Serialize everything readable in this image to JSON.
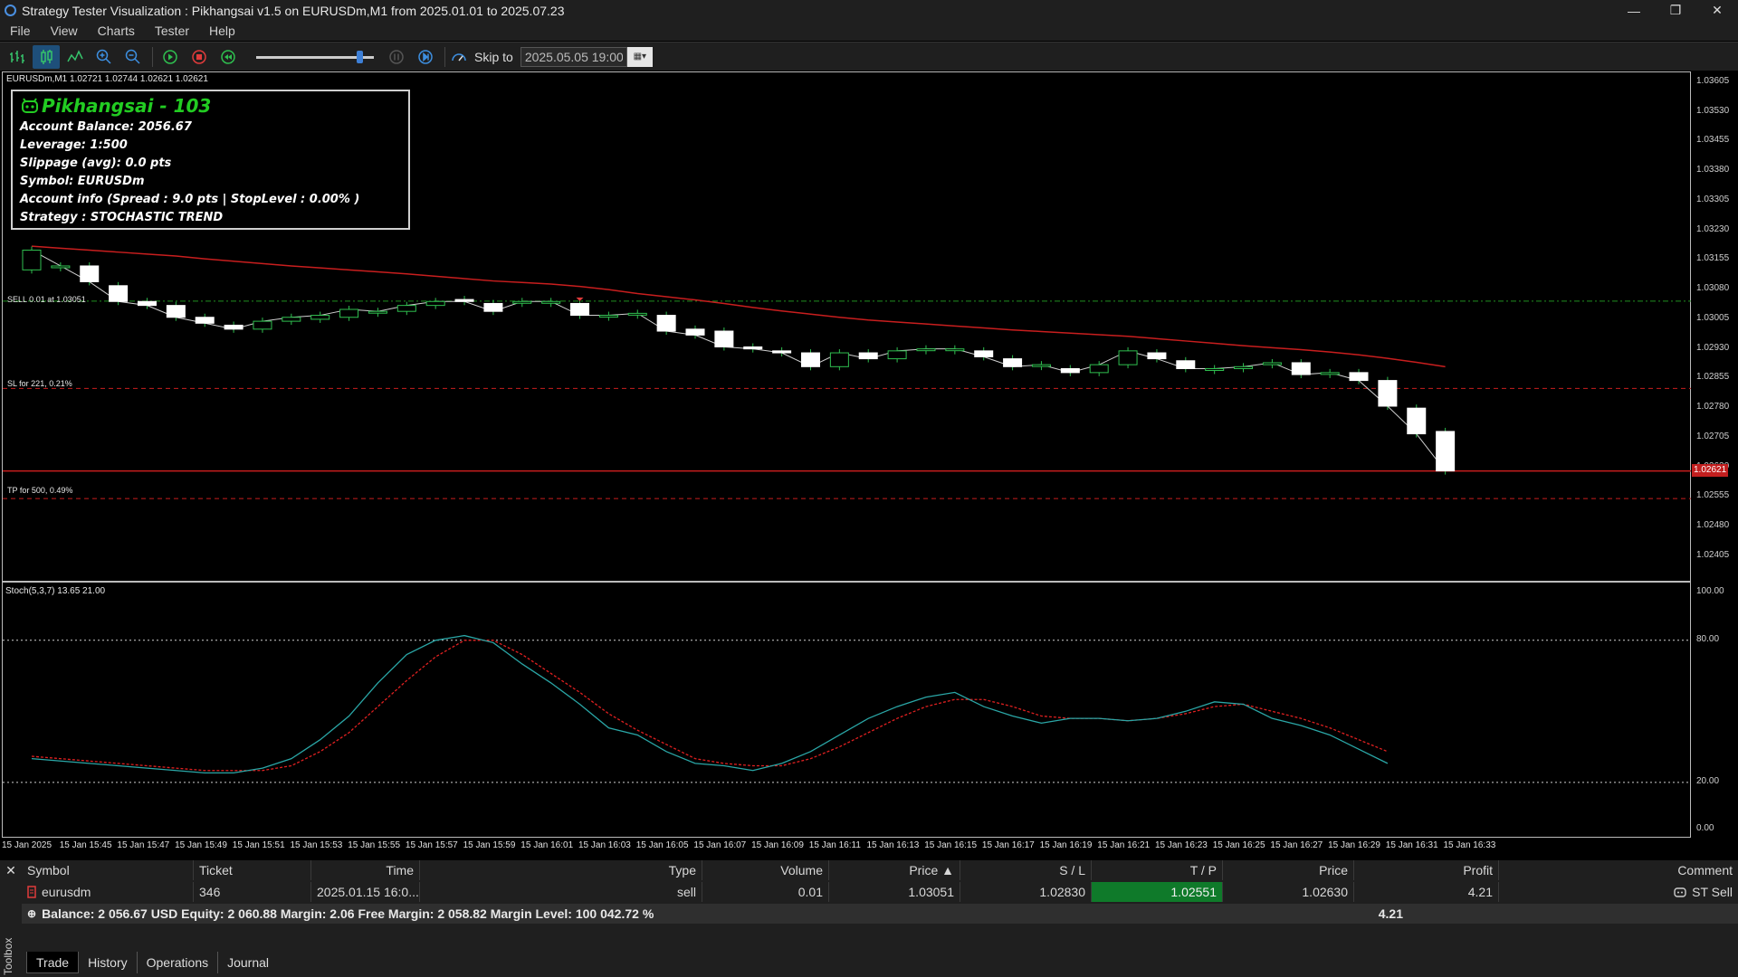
{
  "window": {
    "title": "Strategy Tester Visualization : Pikhangsai v1.5 on EURUSDm,M1 from 2025.01.01 to 2025.07.23",
    "minimize": "—",
    "restore": "❐",
    "close": "✕"
  },
  "menu": [
    "File",
    "View",
    "Charts",
    "Tester",
    "Help"
  ],
  "toolbar": {
    "skip_label": "Skip to",
    "skip_value": "2025.05.05 19:00",
    "speed_fraction": 0.9
  },
  "chart": {
    "header": "EURUSDm,M1  1.02721 1.02744 1.02621 1.02621",
    "stoch_header": "Stoch(5,3,7) 13.65 21.00",
    "price_axis": [
      "1.03605",
      "1.03530",
      "1.03455",
      "1.03380",
      "1.03305",
      "1.03230",
      "1.03155",
      "1.03080",
      "1.03005",
      "1.02930",
      "1.02855",
      "1.02780",
      "1.02705",
      "1.02630",
      "1.02555",
      "1.02480",
      "1.02405"
    ],
    "current_price": "1.02621",
    "stoch_axis": [
      "100.00",
      "80.00",
      "20.00",
      "0.00"
    ],
    "time_axis": [
      "15 Jan 2025",
      "15 Jan 15:45",
      "15 Jan 15:47",
      "15 Jan 15:49",
      "15 Jan 15:51",
      "15 Jan 15:53",
      "15 Jan 15:55",
      "15 Jan 15:57",
      "15 Jan 15:59",
      "15 Jan 16:01",
      "15 Jan 16:03",
      "15 Jan 16:05",
      "15 Jan 16:07",
      "15 Jan 16:09",
      "15 Jan 16:11",
      "15 Jan 16:13",
      "15 Jan 16:15",
      "15 Jan 16:17",
      "15 Jan 16:19",
      "15 Jan 16:21",
      "15 Jan 16:23",
      "15 Jan 16:25",
      "15 Jan 16:27",
      "15 Jan 16:29",
      "15 Jan 16:31",
      "15 Jan 16:33"
    ],
    "levels": {
      "sell": "SELL 0.01 at 1.03051",
      "sl": "SL for 221, 0.21%",
      "tp": "TP for 500, 0.49%"
    },
    "colors": {
      "bull": "#000000",
      "bear": "#ffffff",
      "ma": "#c81e1e",
      "stoch_main": "#2aa6a6",
      "stoch_signal": "#e02020",
      "sell_line": "#1f8f1f",
      "sl_line": "#c81e1e",
      "tp_line": "#c81e1e"
    }
  },
  "info_panel": {
    "title": "Pikhangsai - 103",
    "lines": [
      "Account Balance: 2056.67",
      "Leverage: 1:500",
      "Slippage (avg): 0.0 pts",
      "Symbol: EURUSDm",
      "Account info (Spread : 9.0 pts | StopLevel : 0.00% )",
      "Strategy : STOCHASTIC TREND"
    ]
  },
  "toolbox": {
    "label": "Toolbox",
    "columns": [
      "Symbol",
      "Ticket",
      "Time",
      "Type",
      "Volume",
      "Price ▲",
      "S / L",
      "T / P",
      "Price",
      "Profit",
      "Comment"
    ],
    "row": {
      "symbol": "eurusdm",
      "ticket": "346",
      "time": "2025.01.15 16:0...",
      "type": "sell",
      "volume": "0.01",
      "price": "1.03051",
      "sl": "1.02830",
      "tp": "1.02551",
      "current": "1.02630",
      "profit": "4.21",
      "comment": "ST Sell"
    },
    "balance": "Balance: 2 056.67 USD  Equity: 2 060.88  Margin: 2.06  Free Margin: 2 058.82  Margin Level: 100 042.72 %",
    "balance_profit": "4.21",
    "tabs": [
      "Trade",
      "History",
      "Operations",
      "Journal"
    ]
  },
  "chart_data": {
    "type": "candlestick",
    "candles": [
      {
        "o": 1.0313,
        "c": 1.0318
      },
      {
        "o": 1.0314,
        "c": 1.0314
      },
      {
        "o": 1.0314,
        "c": 1.031
      },
      {
        "o": 1.0309,
        "c": 1.0305
      },
      {
        "o": 1.0305,
        "c": 1.0304
      },
      {
        "o": 1.0304,
        "c": 1.0301
      },
      {
        "o": 1.0301,
        "c": 1.02995
      },
      {
        "o": 1.0299,
        "c": 1.0298
      },
      {
        "o": 1.0298,
        "c": 1.03
      },
      {
        "o": 1.03,
        "c": 1.0301
      },
      {
        "o": 1.03005,
        "c": 1.03015
      },
      {
        "o": 1.0301,
        "c": 1.0303
      },
      {
        "o": 1.03025,
        "c": 1.03025
      },
      {
        "o": 1.03025,
        "c": 1.0304
      },
      {
        "o": 1.0304,
        "c": 1.0305
      },
      {
        "o": 1.03055,
        "c": 1.0305
      },
      {
        "o": 1.03045,
        "c": 1.03025
      },
      {
        "o": 1.0305,
        "c": 1.0305
      },
      {
        "o": 1.0305,
        "c": 1.0305
      },
      {
        "o": 1.03045,
        "c": 1.03015
      },
      {
        "o": 1.03015,
        "c": 1.03015
      },
      {
        "o": 1.0302,
        "c": 1.0302
      },
      {
        "o": 1.03015,
        "c": 1.02975
      },
      {
        "o": 1.0298,
        "c": 1.02965
      },
      {
        "o": 1.02975,
        "c": 1.02935
      },
      {
        "o": 1.02935,
        "c": 1.0293
      },
      {
        "o": 1.02925,
        "c": 1.0292
      },
      {
        "o": 1.0292,
        "c": 1.02885
      },
      {
        "o": 1.02885,
        "c": 1.0292
      },
      {
        "o": 1.0292,
        "c": 1.02905
      },
      {
        "o": 1.02905,
        "c": 1.02925
      },
      {
        "o": 1.0293,
        "c": 1.0293
      },
      {
        "o": 1.0293,
        "c": 1.0293
      },
      {
        "o": 1.02925,
        "c": 1.0291
      },
      {
        "o": 1.02905,
        "c": 1.02885
      },
      {
        "o": 1.0289,
        "c": 1.0289
      },
      {
        "o": 1.0288,
        "c": 1.0287
      },
      {
        "o": 1.0287,
        "c": 1.0289
      },
      {
        "o": 1.0289,
        "c": 1.02925
      },
      {
        "o": 1.0292,
        "c": 1.02905
      },
      {
        "o": 1.029,
        "c": 1.0288
      },
      {
        "o": 1.0288,
        "c": 1.0288
      },
      {
        "o": 1.0288,
        "c": 1.02885
      },
      {
        "o": 1.0289,
        "c": 1.02895
      },
      {
        "o": 1.02895,
        "c": 1.02865
      },
      {
        "o": 1.0287,
        "c": 1.0287
      },
      {
        "o": 1.0287,
        "c": 1.0285
      },
      {
        "o": 1.0285,
        "c": 1.02785
      },
      {
        "o": 1.0278,
        "c": 1.02715
      },
      {
        "o": 1.02721,
        "c": 1.02621
      }
    ],
    "ma": [
      1.0319,
      1.03185,
      1.0318,
      1.03175,
      1.0317,
      1.03165,
      1.03158,
      1.03152,
      1.03146,
      1.0314,
      1.03135,
      1.0313,
      1.03125,
      1.0312,
      1.03114,
      1.03108,
      1.03102,
      1.03098,
      1.03094,
      1.03088,
      1.0308,
      1.0307,
      1.03062,
      1.03054,
      1.03045,
      1.03035,
      1.03026,
      1.03018,
      1.0301,
      1.03003,
      1.02998,
      1.02993,
      1.02988,
      1.02983,
      1.02978,
      1.02974,
      1.0297,
      1.02966,
      1.02962,
      1.02956,
      1.0295,
      1.02944,
      1.02938,
      1.02933,
      1.02928,
      1.02922,
      1.02915,
      1.02906,
      1.02896,
      1.02885
    ],
    "stoch_main": [
      30,
      29,
      28,
      27,
      26,
      25,
      24,
      24,
      26,
      30,
      38,
      48,
      62,
      74,
      80,
      82,
      79,
      70,
      62,
      53,
      43,
      40,
      33,
      28,
      27,
      25,
      28,
      33,
      40,
      47,
      52,
      56,
      58,
      52,
      48,
      45,
      47,
      47,
      46,
      47,
      50,
      54,
      53,
      47,
      44,
      40,
      34,
      28
    ],
    "stoch_signal": [
      31,
      30,
      29,
      28,
      27,
      26,
      25,
      25,
      25,
      27,
      33,
      41,
      52,
      63,
      73,
      80,
      80,
      74,
      66,
      58,
      49,
      42,
      36,
      30,
      28,
      27,
      27,
      30,
      35,
      41,
      47,
      52,
      55,
      55,
      52,
      48,
      47,
      47,
      46,
      47,
      49,
      52,
      53,
      50,
      47,
      43,
      38,
      33
    ],
    "sell_price": 1.03051,
    "sl_price": 1.0283,
    "tp_price": 1.02551
  }
}
